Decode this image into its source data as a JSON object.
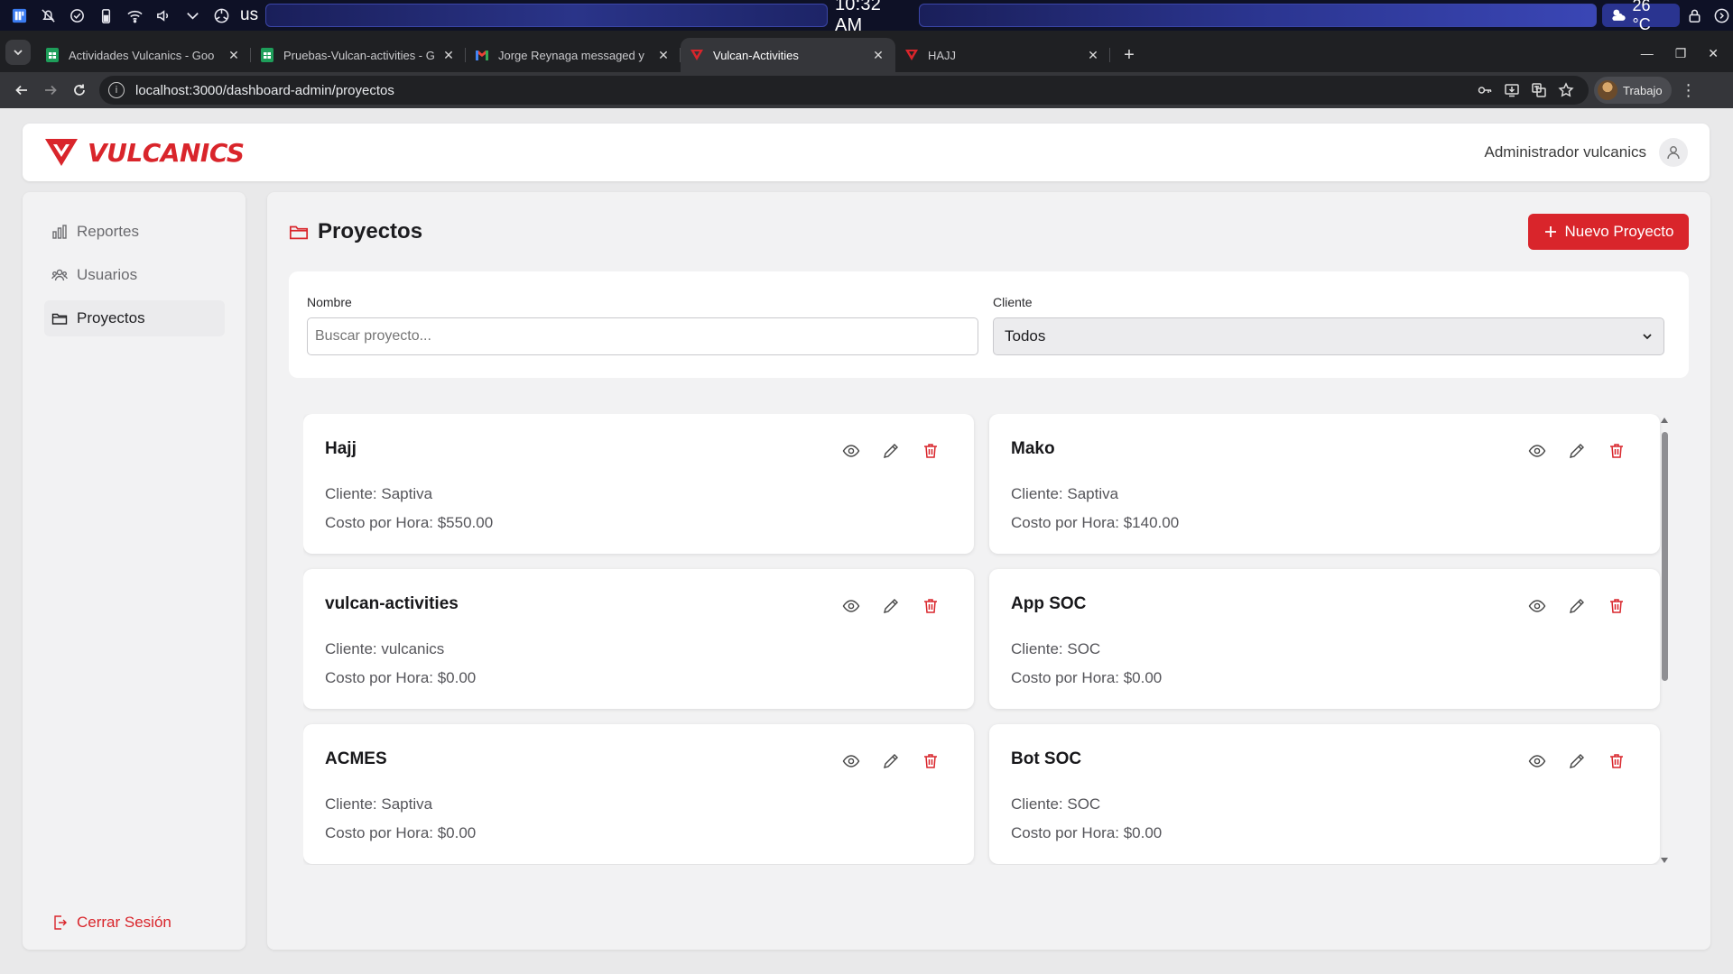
{
  "os": {
    "layout": "us",
    "clock": "10:32 AM",
    "weather": "26 °C",
    "icons": [
      "app-grid-icon",
      "notifications-off-icon",
      "check-circle-icon",
      "battery-icon",
      "wifi-icon",
      "volume-icon",
      "chevron-down-icon",
      "settings-icon"
    ]
  },
  "browser": {
    "tabs": [
      {
        "title": "Actividades Vulcanics - Goo",
        "icon": "google-sheets-icon",
        "active": false
      },
      {
        "title": "Pruebas-Vulcan-activities - G",
        "icon": "google-sheets-icon",
        "active": false
      },
      {
        "title": "Jorge Reynaga messaged y",
        "icon": "gmail-icon",
        "active": false
      },
      {
        "title": "Vulcan-Activities",
        "icon": "vulcanics-icon",
        "active": true
      },
      {
        "title": "HAJJ",
        "icon": "vulcanics-icon",
        "active": false
      }
    ],
    "url": "localhost:3000/dashboard-admin/proyectos",
    "profile_name": "Trabajo"
  },
  "header": {
    "brand": "VULCANICS",
    "admin_name": "Administrador vulcanics"
  },
  "sidebar": {
    "items": [
      {
        "label": "Reportes",
        "icon": "bar-chart-icon"
      },
      {
        "label": "Usuarios",
        "icon": "users-icon"
      },
      {
        "label": "Proyectos",
        "icon": "folder-icon",
        "active": true
      }
    ],
    "logout": "Cerrar Sesión"
  },
  "main": {
    "title": "Proyectos",
    "new_button": "Nuevo Proyecto",
    "filters": {
      "name_label": "Nombre",
      "name_placeholder": "Buscar proyecto...",
      "client_label": "Cliente",
      "client_value": "Todos"
    },
    "projects": [
      {
        "name": "Hajj",
        "client": "Cliente: Saptiva",
        "cost": "Costo por Hora: $550.00"
      },
      {
        "name": "Mako",
        "client": "Cliente: Saptiva",
        "cost": "Costo por Hora: $140.00"
      },
      {
        "name": "vulcan-activities",
        "client": "Cliente: vulcanics",
        "cost": "Costo por Hora: $0.00"
      },
      {
        "name": "App SOC",
        "client": "Cliente: SOC",
        "cost": "Costo por Hora: $0.00"
      },
      {
        "name": "ACMES",
        "client": "Cliente: Saptiva",
        "cost": "Costo por Hora: $0.00"
      },
      {
        "name": "Bot SOC",
        "client": "Cliente: SOC",
        "cost": "Costo por Hora: $0.00"
      }
    ]
  },
  "colors": {
    "brand": "#d9252b",
    "page_bg": "#e9e9ea",
    "panel_bg": "#f2f2f3"
  }
}
